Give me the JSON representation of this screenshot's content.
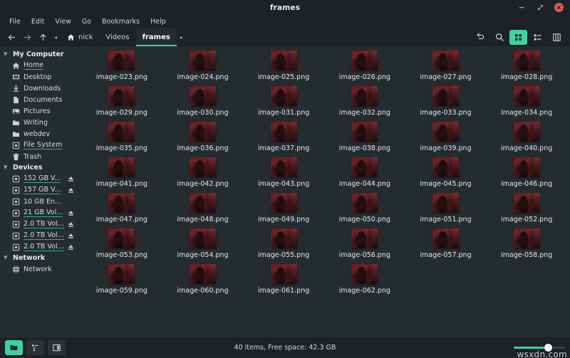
{
  "window": {
    "title": "frames",
    "controls": [
      {
        "name": "minimize",
        "glyph": "minimize-icon"
      },
      {
        "name": "maximize",
        "glyph": "maximize-icon"
      },
      {
        "name": "close",
        "glyph": "close-icon"
      }
    ]
  },
  "menubar": {
    "items": [
      "File",
      "Edit",
      "View",
      "Go",
      "Bookmarks",
      "Help"
    ]
  },
  "toolbar": {
    "nav": [
      {
        "name": "back",
        "icon": "arrow-left-icon"
      },
      {
        "name": "forward",
        "icon": "arrow-right-icon"
      },
      {
        "name": "up",
        "icon": "arrow-up-icon"
      }
    ],
    "breadcrumb_left_chevron": "◂",
    "breadcrumb_right_chevron": "▸",
    "breadcrumbs": [
      {
        "label": "nick",
        "icon": "home-icon",
        "active": false
      },
      {
        "label": "Videos",
        "icon": "",
        "active": false
      },
      {
        "label": "frames",
        "icon": "",
        "active": true
      }
    ],
    "right_buttons": [
      {
        "name": "reload-button",
        "icon": "reload-icon",
        "selected": false
      },
      {
        "name": "search-button",
        "icon": "search-icon",
        "selected": false
      },
      {
        "name": "icon-view-button",
        "icon": "grid-view-icon",
        "selected": true
      },
      {
        "name": "list-view-button",
        "icon": "list-view-icon",
        "selected": false
      },
      {
        "name": "compact-view-button",
        "icon": "compact-view-icon",
        "selected": false
      }
    ]
  },
  "sidebar": {
    "groups": [
      {
        "label": "My Computer",
        "items": [
          {
            "label": "Home",
            "icon": "home-icon",
            "underline": true,
            "eject": false
          },
          {
            "label": "Desktop",
            "icon": "desktop-icon",
            "underline": false,
            "eject": false
          },
          {
            "label": "Downloads",
            "icon": "download-icon",
            "underline": false,
            "eject": false
          },
          {
            "label": "Documents",
            "icon": "document-icon",
            "underline": false,
            "eject": false
          },
          {
            "label": "Pictures",
            "icon": "pictures-icon",
            "underline": false,
            "eject": false
          },
          {
            "label": "Writing",
            "icon": "folder-icon",
            "underline": false,
            "eject": false
          },
          {
            "label": "webdev",
            "icon": "folder-icon",
            "underline": false,
            "eject": false
          },
          {
            "label": "File System",
            "icon": "disk-icon",
            "underline": true,
            "eject": false
          },
          {
            "label": "Trash",
            "icon": "trash-icon",
            "underline": false,
            "eject": false
          }
        ]
      },
      {
        "label": "Devices",
        "items": [
          {
            "label": "152 GB V...",
            "icon": "disk-icon",
            "underline": true,
            "eject": true
          },
          {
            "label": "157 GB V...",
            "icon": "disk-icon",
            "underline": true,
            "eject": true
          },
          {
            "label": "10 GB En...",
            "icon": "disk-icon",
            "underline": false,
            "eject": false
          },
          {
            "label": "21 GB Vol...",
            "icon": "disk-icon",
            "underline": true,
            "eject": true
          },
          {
            "label": "2.0 TB Vol...",
            "icon": "disk-icon",
            "underline": true,
            "eject": true
          },
          {
            "label": "2.0 TB Vol...",
            "icon": "disk-icon",
            "underline": true,
            "eject": true
          },
          {
            "label": "2.0 TB Vol...",
            "icon": "disk-icon",
            "underline": true,
            "eject": true
          }
        ]
      },
      {
        "label": "Network",
        "items": [
          {
            "label": "Network",
            "icon": "globe-icon",
            "underline": false,
            "eject": false
          }
        ]
      }
    ]
  },
  "files": [
    {
      "name": "image-023.png"
    },
    {
      "name": "image-024.png"
    },
    {
      "name": "image-025.png"
    },
    {
      "name": "image-026.png"
    },
    {
      "name": "image-027.png"
    },
    {
      "name": "image-028.png"
    },
    {
      "name": "image-029.png"
    },
    {
      "name": "image-030.png"
    },
    {
      "name": "image-031.png"
    },
    {
      "name": "image-032.png"
    },
    {
      "name": "image-033.png"
    },
    {
      "name": "image-034.png"
    },
    {
      "name": "image-035.png"
    },
    {
      "name": "image-036.png"
    },
    {
      "name": "image-037.png"
    },
    {
      "name": "image-038.png"
    },
    {
      "name": "image-039.png"
    },
    {
      "name": "image-040.png"
    },
    {
      "name": "image-041.png"
    },
    {
      "name": "image-042.png"
    },
    {
      "name": "image-043.png"
    },
    {
      "name": "image-044.png"
    },
    {
      "name": "image-045.png"
    },
    {
      "name": "image-046.png"
    },
    {
      "name": "image-047.png"
    },
    {
      "name": "image-048.png"
    },
    {
      "name": "image-049.png"
    },
    {
      "name": "image-050.png"
    },
    {
      "name": "image-051.png"
    },
    {
      "name": "image-052.png"
    },
    {
      "name": "image-053.png"
    },
    {
      "name": "image-054.png"
    },
    {
      "name": "image-055.png"
    },
    {
      "name": "image-056.png"
    },
    {
      "name": "image-057.png"
    },
    {
      "name": "image-058.png"
    },
    {
      "name": "image-059.png"
    },
    {
      "name": "image-060.png"
    },
    {
      "name": "image-061.png"
    },
    {
      "name": "image-062.png"
    }
  ],
  "statusbar": {
    "text": "40 items, Free space: 42.3 GB",
    "buttons": [
      {
        "name": "icon-view-toggle",
        "icon": "folder-icon",
        "selected": true
      },
      {
        "name": "tree-view-toggle",
        "icon": "tree-icon",
        "selected": false
      },
      {
        "name": "preview-pane-toggle",
        "icon": "panel-icon",
        "selected": false
      }
    ],
    "zoom_percent": 66,
    "watermark": "wsxdn.com"
  },
  "colors": {
    "accent": "#3fd2a0",
    "underline": "#2fae86",
    "close": "#cf5a5e",
    "bg": "#252c30",
    "chrome": "#1c2225"
  }
}
